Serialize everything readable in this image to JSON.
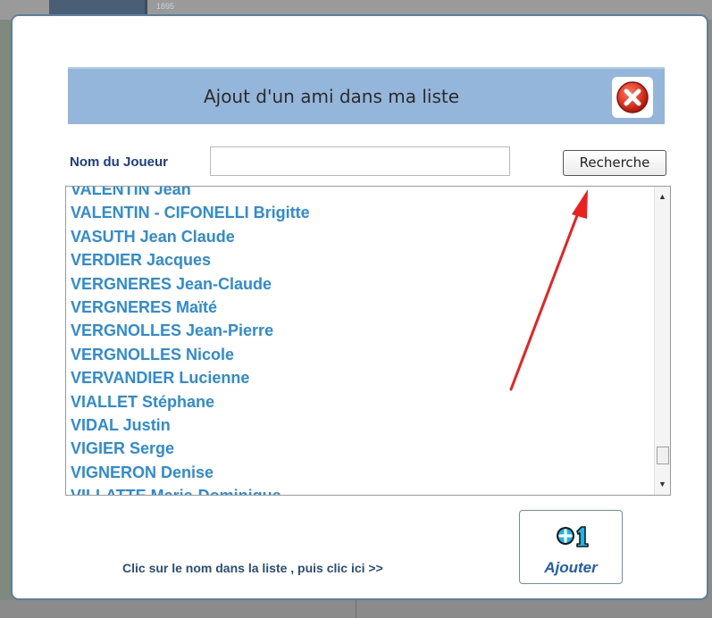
{
  "background": {
    "logo_text": "1895"
  },
  "dialog": {
    "title": "Ajout d'un ami dans ma liste",
    "close_icon": "close-x-icon"
  },
  "search": {
    "label": "Nom du Joueur",
    "value": "",
    "placeholder": "",
    "button_label": "Recherche"
  },
  "players": [
    "VALENTIN Jean",
    "VALENTIN - CIFONELLI Brigitte",
    "VASUTH Jean Claude",
    "VERDIER Jacques",
    "VERGNERES Jean-Claude",
    "VERGNERES Maïté",
    "VERGNOLLES Jean-Pierre",
    "VERGNOLLES Nicole",
    "VERVANDIER Lucienne",
    "VIALLET Stéphane",
    "VIDAL Justin",
    "VIGIER Serge",
    "VIGNERON Denise",
    "VILLATTE Marie-Dominique"
  ],
  "footer": {
    "instruction": "Clic sur le nom dans la  liste , puis clic ici >>",
    "add_icon": "plus-one-icon",
    "add_label": "Ajouter"
  },
  "colors": {
    "header_bg": "#95b6db",
    "list_text": "#2c8cd6",
    "label_text": "#1b3e8c",
    "annotation_arrow": "#ee1f1f",
    "close_red": "#d8281c"
  }
}
